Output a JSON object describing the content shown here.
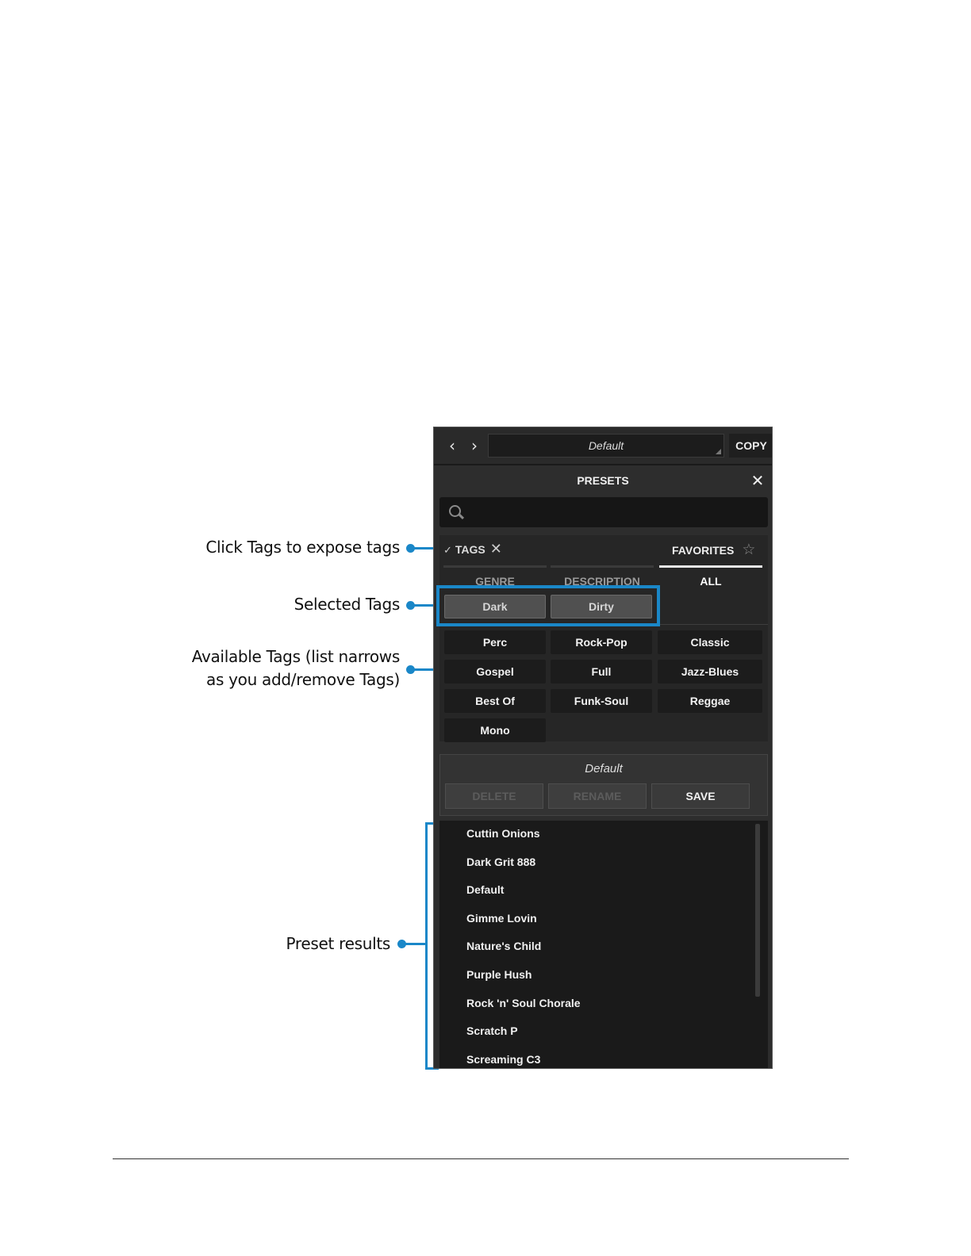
{
  "callouts": {
    "tags": "Click Tags to expose tags",
    "selected": "Selected Tags",
    "available_line1": "Available Tags (list narrows",
    "available_line2": "as you add/remove Tags)",
    "results": "Preset results"
  },
  "accent_color": "#1a87c8",
  "topbar": {
    "prev_icon": "‹",
    "next_icon": "›",
    "current_preset": "Default",
    "copy_label": "COPY"
  },
  "panel": {
    "title": "PRESETS",
    "close_icon": "✕",
    "search_placeholder": ""
  },
  "tabs": {
    "check": "✓",
    "tags_label": "TAGS",
    "tags_close": "✕",
    "favorites_label": "FAVORITES",
    "favorites_star": "☆",
    "sub": [
      "GENRE",
      "DESCRIPTION",
      "ALL"
    ],
    "active_sub": "ALL"
  },
  "selected_tags": [
    "Dark",
    "Dirty"
  ],
  "available_tags": [
    "Perc",
    "Rock-Pop",
    "Classic",
    "Gospel",
    "Full",
    "Jazz-Blues",
    "Best Of",
    "Funk-Soul",
    "Reggae",
    "Mono"
  ],
  "manage": {
    "title": "Default",
    "delete_label": "DELETE",
    "rename_label": "RENAME",
    "save_label": "SAVE"
  },
  "results": [
    "Cuttin Onions",
    "Dark Grit 888",
    "Default",
    "Gimme Lovin",
    "Nature's Child",
    "Purple Hush",
    "Rock 'n' Soul Chorale",
    "Scratch P",
    "Screaming C3"
  ]
}
